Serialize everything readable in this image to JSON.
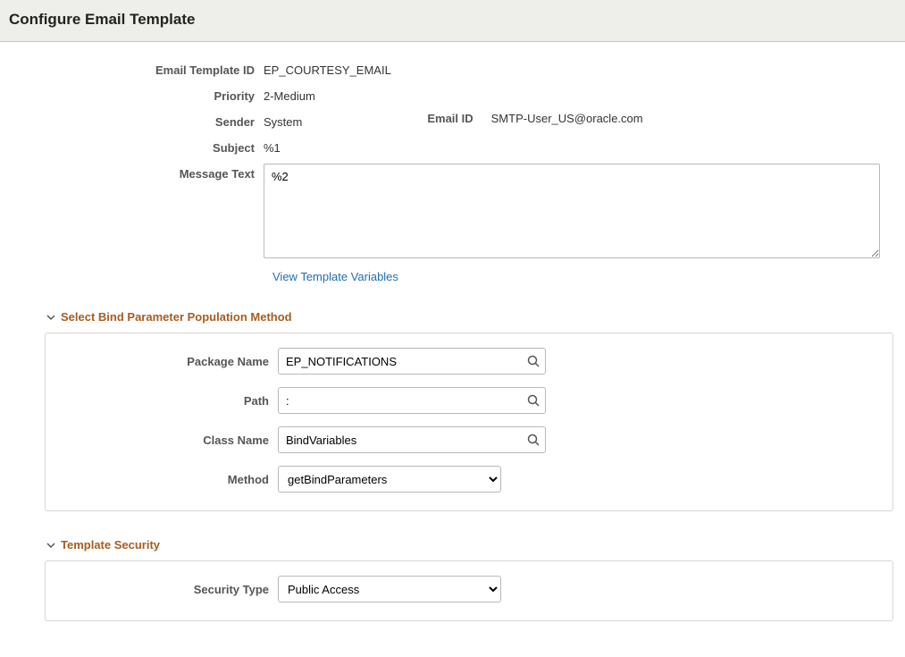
{
  "header": {
    "title": "Configure Email Template"
  },
  "template": {
    "id_label": "Email Template ID",
    "id_value": "EP_COURTESY_EMAIL",
    "priority_label": "Priority",
    "priority_value": "2-Medium",
    "sender_label": "Sender",
    "sender_value": "System",
    "emailid_label": "Email ID",
    "emailid_value": "SMTP-User_US@oracle.com",
    "subject_label": "Subject",
    "subject_value": "%1",
    "message_label": "Message Text",
    "message_value": "%2",
    "view_vars_label": "View Template Variables"
  },
  "bind_section": {
    "title": "Select Bind Parameter Population Method",
    "package_label": "Package Name",
    "package_value": "EP_NOTIFICATIONS",
    "path_label": "Path",
    "path_value": ":",
    "class_label": "Class Name",
    "class_value": "BindVariables",
    "method_label": "Method",
    "method_value": "getBindParameters"
  },
  "security_section": {
    "title": "Template Security",
    "type_label": "Security Type",
    "type_value": "Public Access"
  }
}
